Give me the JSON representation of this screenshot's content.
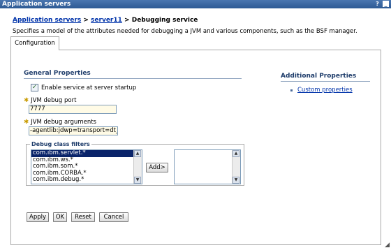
{
  "window": {
    "title": "Application servers",
    "help_glyph": "?",
    "minimize_glyph": "_"
  },
  "breadcrumb": {
    "root": "Application servers",
    "sep1": ">",
    "server": "server11",
    "sep2": ">",
    "current": "Debugging service"
  },
  "description": "Specifies a model of the attributes needed for debugging a JVM and various components, such as the BSF manager.",
  "tabs": [
    {
      "label": "Configuration"
    }
  ],
  "general": {
    "heading": "General Properties",
    "enable_label": "Enable service at server startup",
    "enable_checked": true,
    "port_label": "JVM debug port",
    "port_value": "7777",
    "args_label": "JVM debug arguments",
    "args_value": "-agentlib:jdwp=transport=dt_",
    "required_glyph": "✱"
  },
  "filters": {
    "legend": "Debug class filters",
    "items": [
      "com.ibm.servlet.*",
      "com.ibm.ws.*",
      "com.ibm.som.*",
      "com.ibm.CORBA.*",
      "com.ibm.debug.*"
    ],
    "selected_index": 0,
    "add_label": "Add>"
  },
  "additional": {
    "heading": "Additional Properties",
    "links": [
      "Custom properties"
    ]
  },
  "buttons": {
    "apply": "Apply",
    "ok": "OK",
    "reset": "Reset",
    "cancel": "Cancel"
  },
  "colors": {
    "titlebar": "#2d5a94",
    "link": "#0033aa",
    "selection": "#0a246a",
    "field_bg": "#fffbe6"
  }
}
